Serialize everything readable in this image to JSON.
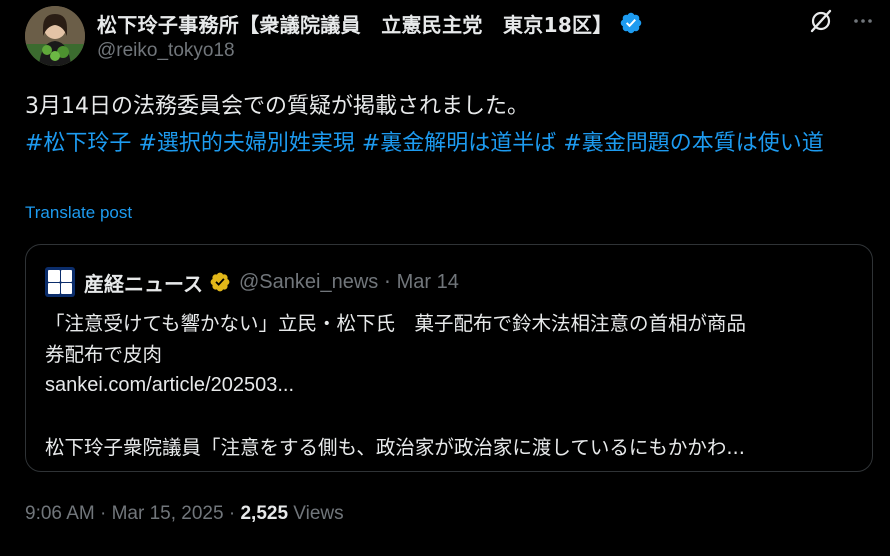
{
  "author": {
    "display_name": "松下玲子事務所【衆議院議員　立憲民主党　東京18区】",
    "handle": "@reiko_tokyo18",
    "verified_color": "#1d9bf0"
  },
  "top_icons": {
    "grok": "grok-icon",
    "more": "more-icon"
  },
  "post": {
    "text_line1": "3月14日の法務委員会での質疑が掲載されました。",
    "hashtags": [
      "#松下玲子",
      "#選択的夫婦別姓実現",
      "#裏金解明は道半ば",
      "#裏金問題の本質は使い道"
    ],
    "translate_label": "Translate post"
  },
  "quote": {
    "name": "産経ニュース",
    "handle": "@Sankei_news",
    "separator": "·",
    "date": "Mar 14",
    "verified_color": "#e2b719",
    "line1": "「注意受けても響かない」立民・松下氏　菓子配布で鈴木法相注意の首相が商品",
    "line2": "券配布で皮肉",
    "link": "sankei.com/article/202503...",
    "line4": "松下玲子衆院議員「注意をする側も、政治家が政治家に渡しているにもかかわ..."
  },
  "meta": {
    "time": "9:06 AM",
    "sep1": "·",
    "date": "Mar 15, 2025",
    "sep2": "·",
    "views_count": "2,525",
    "views_label": "Views"
  }
}
